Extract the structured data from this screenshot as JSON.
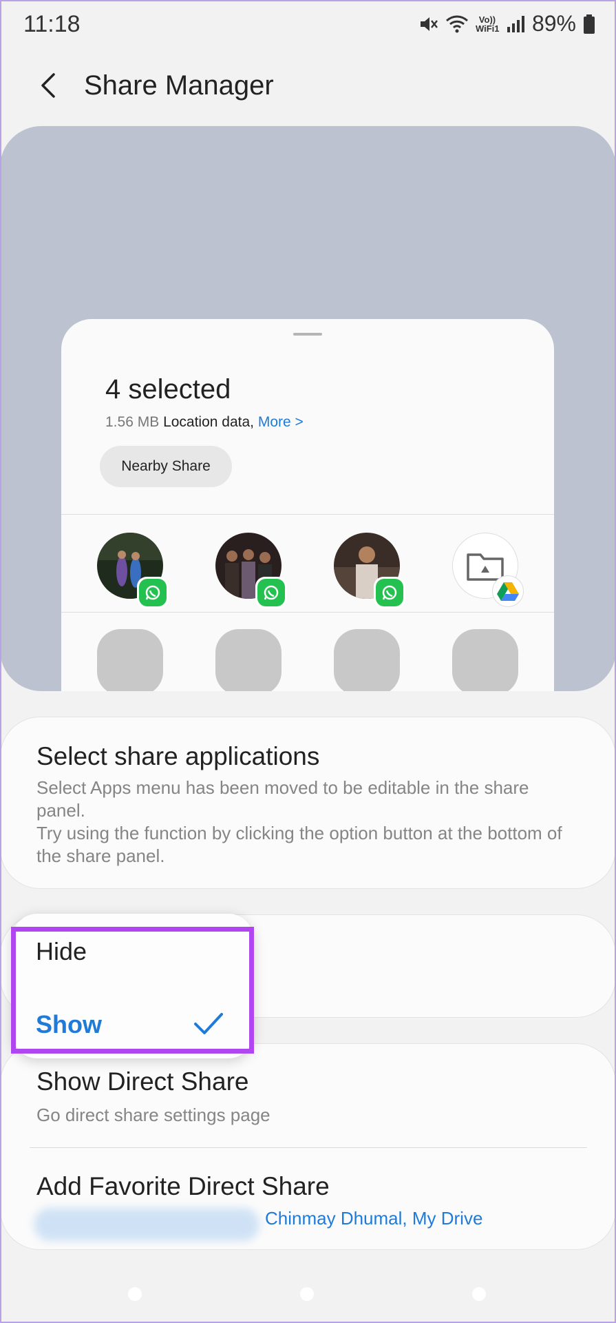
{
  "status_bar": {
    "time": "11:18",
    "volte_label": "Vo)) WiFi1",
    "battery_text": "89%",
    "icons": [
      "mute-icon",
      "wifi-icon",
      "volte-icon",
      "signal-icon",
      "battery-icon"
    ]
  },
  "header": {
    "title": "Share Manager",
    "back_icon": "back-arrow-icon"
  },
  "preview": {
    "selection_title": "4 selected",
    "size": "1.56 MB",
    "location_text": "Location data,",
    "more_link": "More >",
    "nearby_button": "Nearby Share",
    "direct_share_targets": [
      {
        "type": "contact",
        "badge": "whatsapp-icon"
      },
      {
        "type": "contact",
        "badge": "whatsapp-icon"
      },
      {
        "type": "contact",
        "badge": "whatsapp-icon"
      },
      {
        "type": "drive-folder",
        "badge": "google-drive-icon"
      }
    ],
    "app_placeholders": 4
  },
  "select_apps_card": {
    "title": "Select share applications",
    "description": "Select Apps menu has been moved to be editable in the share panel.\nTry using the function by clicking the option button at the bottom of the share panel."
  },
  "direct_share_card": {
    "title": "Show Direct Share",
    "subtitle": "Go direct share settings page"
  },
  "favorite_card": {
    "title": "Add Favorite Direct Share",
    "names": "Chinmay Dhumal, My Drive"
  },
  "dropdown": {
    "options": [
      "Hide",
      "Show"
    ],
    "selected": "Show"
  },
  "colors": {
    "accent": "#1f7ad8",
    "highlight": "#b046f0",
    "preview_bg": "#bcc2cf",
    "whatsapp": "#25c150"
  }
}
